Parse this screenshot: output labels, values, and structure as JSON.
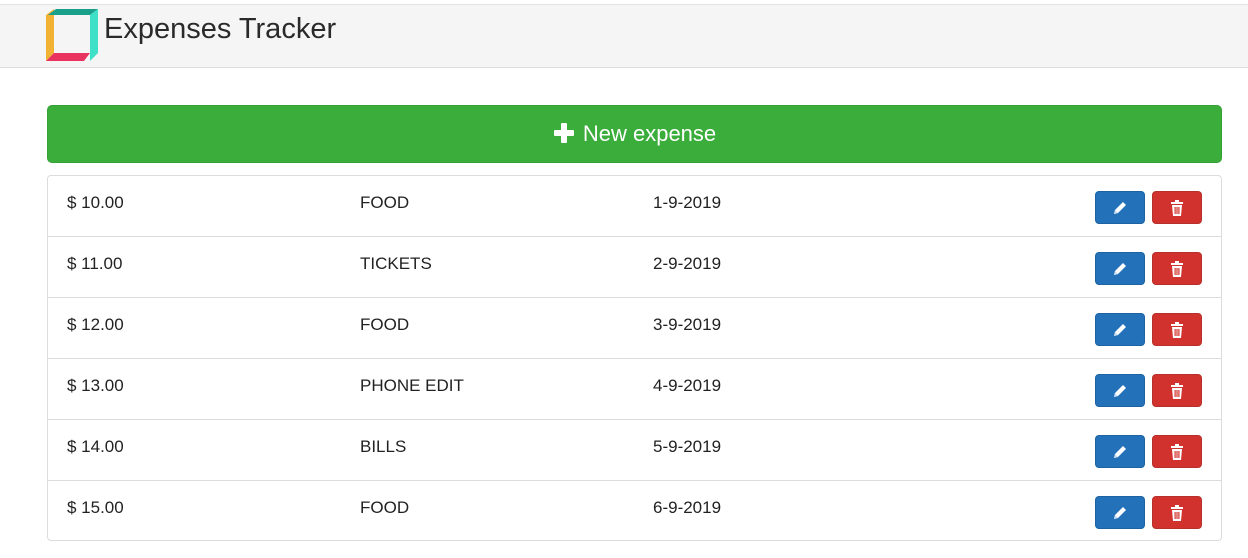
{
  "header": {
    "title": "Expenses Tracker",
    "logo_icon": "logo-icon"
  },
  "actions": {
    "new_expense_label": "New expense",
    "new_expense_icon": "plus-icon",
    "button_color": "#3aad3a"
  },
  "expenses": [
    {
      "amount": "$ 10.00",
      "category": "FOOD",
      "date": "1-9-2019"
    },
    {
      "amount": "$ 11.00",
      "category": "TICKETS",
      "date": "2-9-2019"
    },
    {
      "amount": "$ 12.00",
      "category": "FOOD",
      "date": "3-9-2019"
    },
    {
      "amount": "$ 13.00",
      "category": "PHONE EDIT",
      "date": "4-9-2019"
    },
    {
      "amount": "$ 14.00",
      "category": "BILLS",
      "date": "5-9-2019"
    },
    {
      "amount": "$ 15.00",
      "category": "FOOD",
      "date": "6-9-2019"
    }
  ],
  "row_actions": {
    "edit_icon": "pencil-icon",
    "delete_icon": "trash-icon",
    "edit_color": "#2371b9",
    "delete_color": "#d2322d"
  }
}
